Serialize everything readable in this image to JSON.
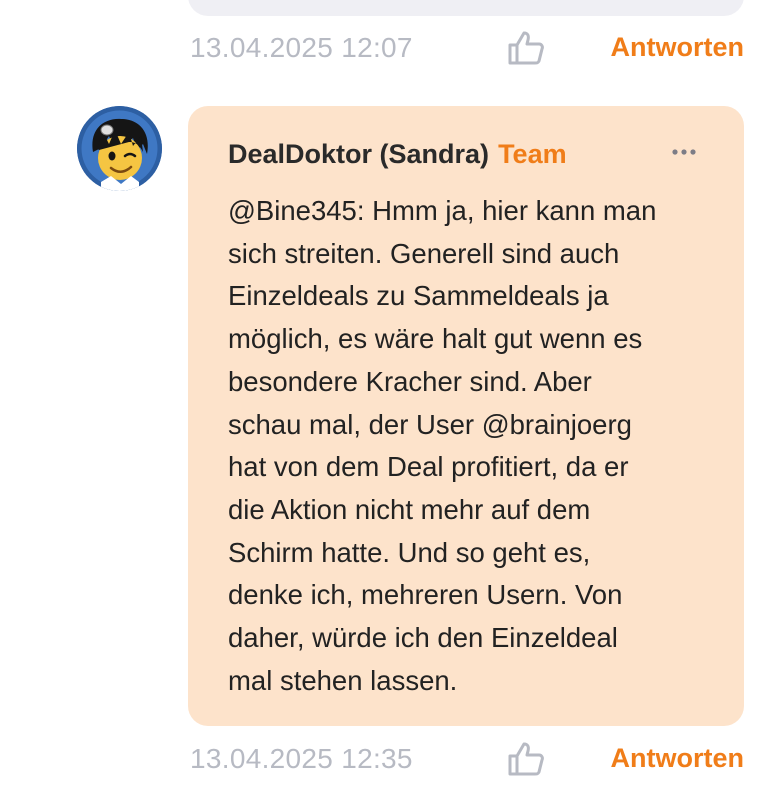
{
  "previous_comment": {
    "timestamp": "13.04.2025 12:07",
    "reply_label": "Antworten",
    "like_icon": "thumbs-up-icon"
  },
  "comment": {
    "avatar_icon": "avatar-cartoon-doctor",
    "author": "DealDoktor (Sandra)",
    "badge": "Team",
    "more_icon": "more-dots-icon",
    "body": "@Bine345: Hmm ja, hier kann man\nsich streiten. Generell sind auch\nEinzeldeals zu Sammeldeals ja\nmöglich, es wäre halt gut wenn es\nbesondere Kracher sind. Aber\nschau mal, der User @brainjoerg\nhat von dem Deal profitiert, da er\ndie Aktion nicht mehr auf dem\nSchirm hatte. Und so geht es,\ndenke ich, mehreren Usern. Von\ndaher, würde ich den Einzeldeal\nmal stehen lassen.",
    "timestamp": "13.04.2025 12:35",
    "reply_label": "Antworten",
    "like_icon": "thumbs-up-icon"
  },
  "colors": {
    "accent": "#f07d19",
    "bubble_team": "#fde3cb",
    "bubble_default": "#efeff4",
    "meta_text": "#b7bac3"
  }
}
